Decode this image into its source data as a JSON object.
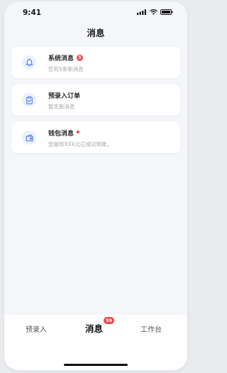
{
  "status_bar": {
    "time": "9:41",
    "icons": [
      "signal-icon",
      "wifi-icon",
      "battery-icon"
    ]
  },
  "header": {
    "title": "消息"
  },
  "messages": [
    {
      "title": "系统消息",
      "badge": "5",
      "subtitle": "您有5条新消息",
      "icon": "bell-icon"
    },
    {
      "title": "预录入订单",
      "subtitle": "暂无新消息",
      "icon": "clipboard-check-icon"
    },
    {
      "title": "钱包消息",
      "badge_dot": true,
      "subtitle": "您提现XXX元已成功到账。",
      "icon": "wallet-icon"
    }
  ],
  "tabbar": {
    "left_label": "预录入",
    "active_label": "消息",
    "active_badge": "99",
    "right_label": "工作台"
  },
  "colors": {
    "accent": "#3b6fe8",
    "badge": "#f04545",
    "background": "#f4f6f9"
  }
}
